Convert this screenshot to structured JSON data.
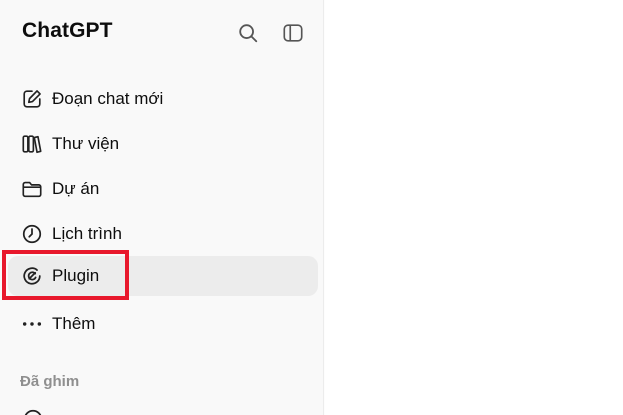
{
  "sidebar": {
    "brand": "ChatGPT",
    "header_icons": [
      "search-icon",
      "sidebar-toggle-icon"
    ],
    "items": [
      {
        "label": "Đoạn chat mới",
        "icon": "new-chat-icon"
      },
      {
        "label": "Thư viện",
        "icon": "library-icon"
      },
      {
        "label": "Dự án",
        "icon": "folder-icon"
      },
      {
        "label": "Lịch trình",
        "icon": "clock-icon"
      },
      {
        "label": "Plugin",
        "icon": "plugin-icon",
        "active": true
      },
      {
        "label": "Thêm",
        "icon": "more-icon"
      }
    ],
    "pinned_label": "Đã ghim"
  },
  "colors": {
    "highlight": "#e8182c",
    "active_bg": "#ececec",
    "sidebar_bg": "#f9f9f9"
  }
}
